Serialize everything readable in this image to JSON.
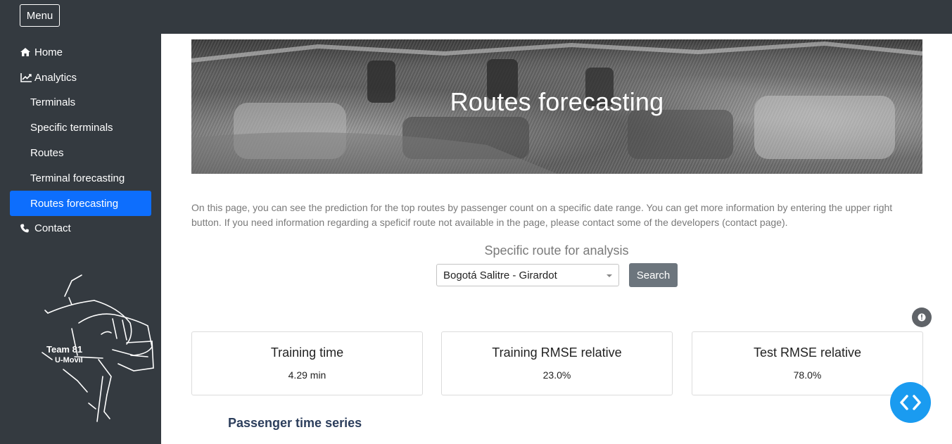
{
  "header": {
    "menu_label": "Menu"
  },
  "sidebar": {
    "items": [
      {
        "label": "Home",
        "icon": "home-icon"
      },
      {
        "label": "Analytics",
        "icon": "chart-line-icon"
      },
      {
        "label": "Terminals"
      },
      {
        "label": "Specific terminals"
      },
      {
        "label": "Routes"
      },
      {
        "label": "Terminal forecasting"
      },
      {
        "label": "Routes forecasting",
        "active": true
      },
      {
        "label": "Contact",
        "icon": "phone-icon"
      }
    ],
    "logo": {
      "line1": "Team 81",
      "line2": "U-Movil"
    }
  },
  "banner": {
    "title": "Routes forecasting"
  },
  "intro_text": "On this page, you can see the prediction for the top routes by passenger count on a specific date range. You can get more information by entering the upper right button. If you need information regarding a speficif route not available in the page, please contact some of the developers (contact page).",
  "route_filter": {
    "label": "Specific route for analysis",
    "selected": "Bogotá Salitre - Girardot",
    "search_label": "Search"
  },
  "metrics": [
    {
      "title": "Training time",
      "value": "4.29 min"
    },
    {
      "title": "Training RMSE relative",
      "value": "23.0%"
    },
    {
      "title": "Test RMSE relative",
      "value": "78.0%"
    }
  ],
  "section_title": "Passenger time series",
  "colors": {
    "sidebar_bg": "#343a40",
    "active_bg": "#0d6efd",
    "search_bg": "#6c757d",
    "code_btn_bg": "#1a9bf0",
    "section_title": "#2c3e5c"
  }
}
